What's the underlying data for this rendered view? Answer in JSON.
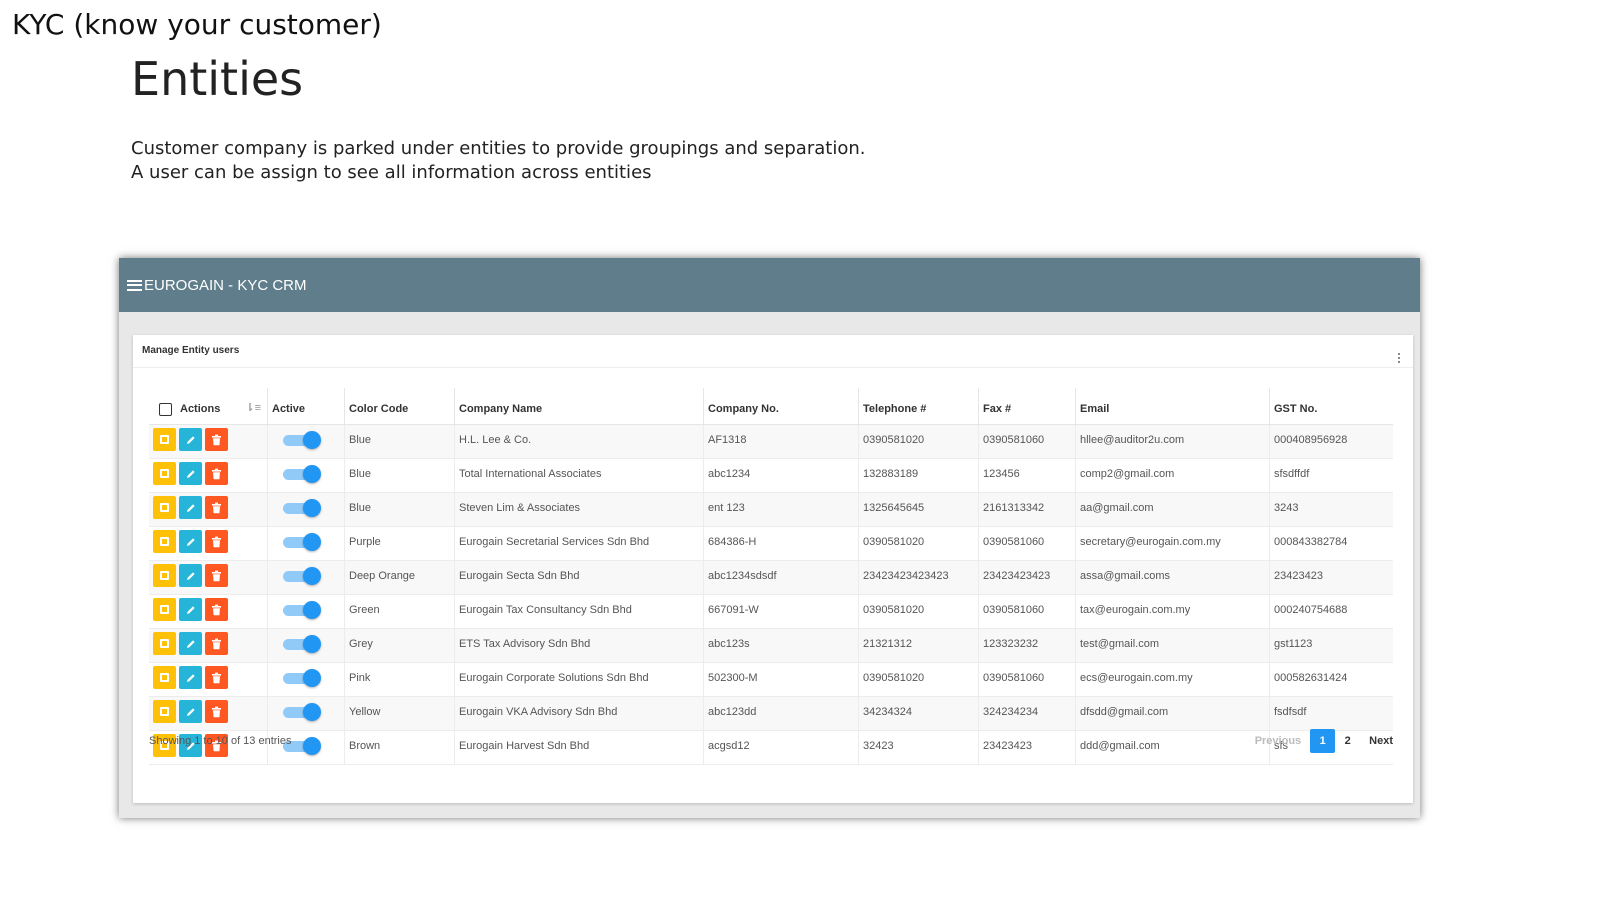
{
  "slide": {
    "heading": "KYC (know your customer)",
    "title": "Entities",
    "description_lines": [
      "Customer company is parked under entities to provide groupings and separation.",
      "A user can be assign to see all information across entities"
    ]
  },
  "app": {
    "title": "EUROGAIN - KYC CRM",
    "header_color": "#607d8b"
  },
  "card": {
    "title": "Manage Entity users"
  },
  "table": {
    "columns": [
      "Actions",
      "Active",
      "Color Code",
      "Company Name",
      "Company No.",
      "Telephone #",
      "Fax #",
      "Email",
      "GST No."
    ],
    "rows": [
      {
        "active": true,
        "color": "Blue",
        "company": "H.L. Lee & Co.",
        "company_no": "AF1318",
        "telephone": "0390581020",
        "fax": "0390581060",
        "email": "hllee@auditor2u.com",
        "gst": "000408956928"
      },
      {
        "active": true,
        "color": "Blue",
        "company": "Total International Associates",
        "company_no": "abc1234",
        "telephone": "132883189",
        "fax": "123456",
        "email": "comp2@gmail.com",
        "gst": "sfsdffdf"
      },
      {
        "active": true,
        "color": "Blue",
        "company": "Steven Lim & Associates",
        "company_no": "ent 123",
        "telephone": "1325645645",
        "fax": "2161313342",
        "email": "aa@gmail.com",
        "gst": "3243"
      },
      {
        "active": true,
        "color": "Purple",
        "company": "Eurogain Secretarial Services Sdn Bhd",
        "company_no": "684386-H",
        "telephone": "0390581020",
        "fax": "0390581060",
        "email": "secretary@eurogain.com.my",
        "gst": "000843382784"
      },
      {
        "active": true,
        "color": "Deep Orange",
        "company": "Eurogain Secta Sdn Bhd",
        "company_no": "abc1234sdsdf",
        "telephone": "23423423423423",
        "fax": "23423423423",
        "email": "assa@gmail.coms",
        "gst": "23423423"
      },
      {
        "active": true,
        "color": "Green",
        "company": "Eurogain Tax Consultancy Sdn Bhd",
        "company_no": "667091-W",
        "telephone": "0390581020",
        "fax": "0390581060",
        "email": "tax@eurogain.com.my",
        "gst": "000240754688"
      },
      {
        "active": true,
        "color": "Grey",
        "company": "ETS Tax Advisory Sdn Bhd",
        "company_no": "abc123s",
        "telephone": "21321312",
        "fax": "123323232",
        "email": "test@gmail.com",
        "gst": "gst1123"
      },
      {
        "active": true,
        "color": "Pink",
        "company": "Eurogain Corporate Solutions Sdn Bhd",
        "company_no": "502300-M",
        "telephone": "0390581020",
        "fax": "0390581060",
        "email": "ecs@eurogain.com.my",
        "gst": "000582631424"
      },
      {
        "active": true,
        "color": "Yellow",
        "company": "Eurogain VKA Advisory Sdn Bhd",
        "company_no": "abc123dd",
        "telephone": "34234324",
        "fax": "324234234",
        "email": "dfsdd@gmail.com",
        "gst": "fsdfsdf"
      },
      {
        "active": true,
        "color": "Brown",
        "company": "Eurogain Harvest Sdn Bhd",
        "company_no": "acgsd12",
        "telephone": "32423",
        "fax": "23423423",
        "email": "ddd@gmail.com",
        "gst": "sfs"
      }
    ]
  },
  "footer": {
    "info": "Showing 1 to 10 of 13 entries",
    "previous": "Previous",
    "pages": [
      "1",
      "2"
    ],
    "active_page": "1",
    "next": "Next"
  },
  "colors": {
    "view_button": "#ffc107",
    "edit_button": "#26b5d9",
    "delete_button": "#ff5722",
    "toggle_on": "#2196f3"
  }
}
